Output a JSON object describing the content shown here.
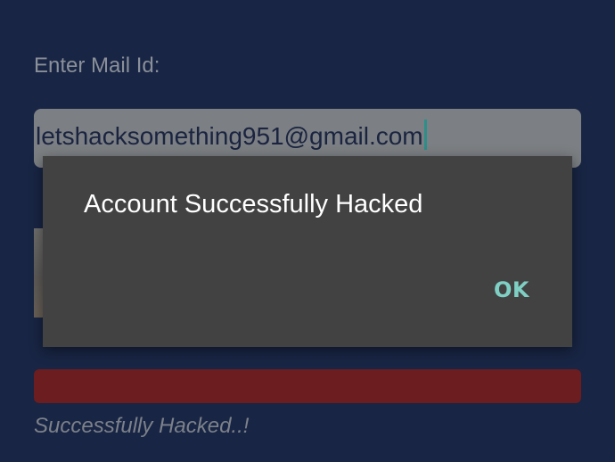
{
  "form": {
    "mail_label": "Enter Mail Id:",
    "mail_value": "letshacksomething951@gmail.com",
    "status_text": "Successfully Hacked..!"
  },
  "dialog": {
    "message": "Account Successfully Hacked",
    "ok_label": "OK"
  },
  "colors": {
    "background": "#182544",
    "dialog_bg": "#424242",
    "accent": "#7fd0c4",
    "progress": "#6b1d1f"
  }
}
